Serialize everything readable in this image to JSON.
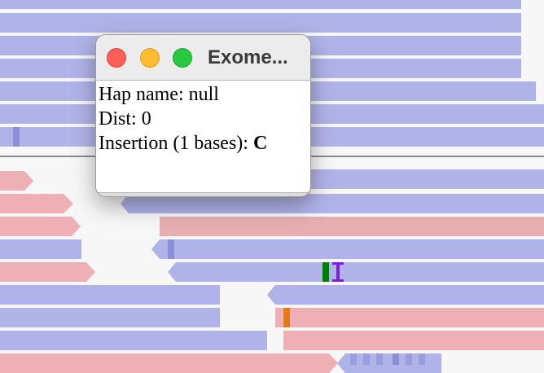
{
  "popup": {
    "title": "Exome...",
    "hap_name_label": "Hap name:",
    "hap_name_value": "null",
    "dist_label": "Dist:",
    "dist_value": "0",
    "insertion_label": "Insertion (1 bases):",
    "insertion_value": "C"
  },
  "colors": {
    "forward_read": "#b0b3e8",
    "reverse_read": "#eeb0b4",
    "base_A": "#008000",
    "base_C": "#e07b1a",
    "insertion": "#7a1fd6"
  }
}
